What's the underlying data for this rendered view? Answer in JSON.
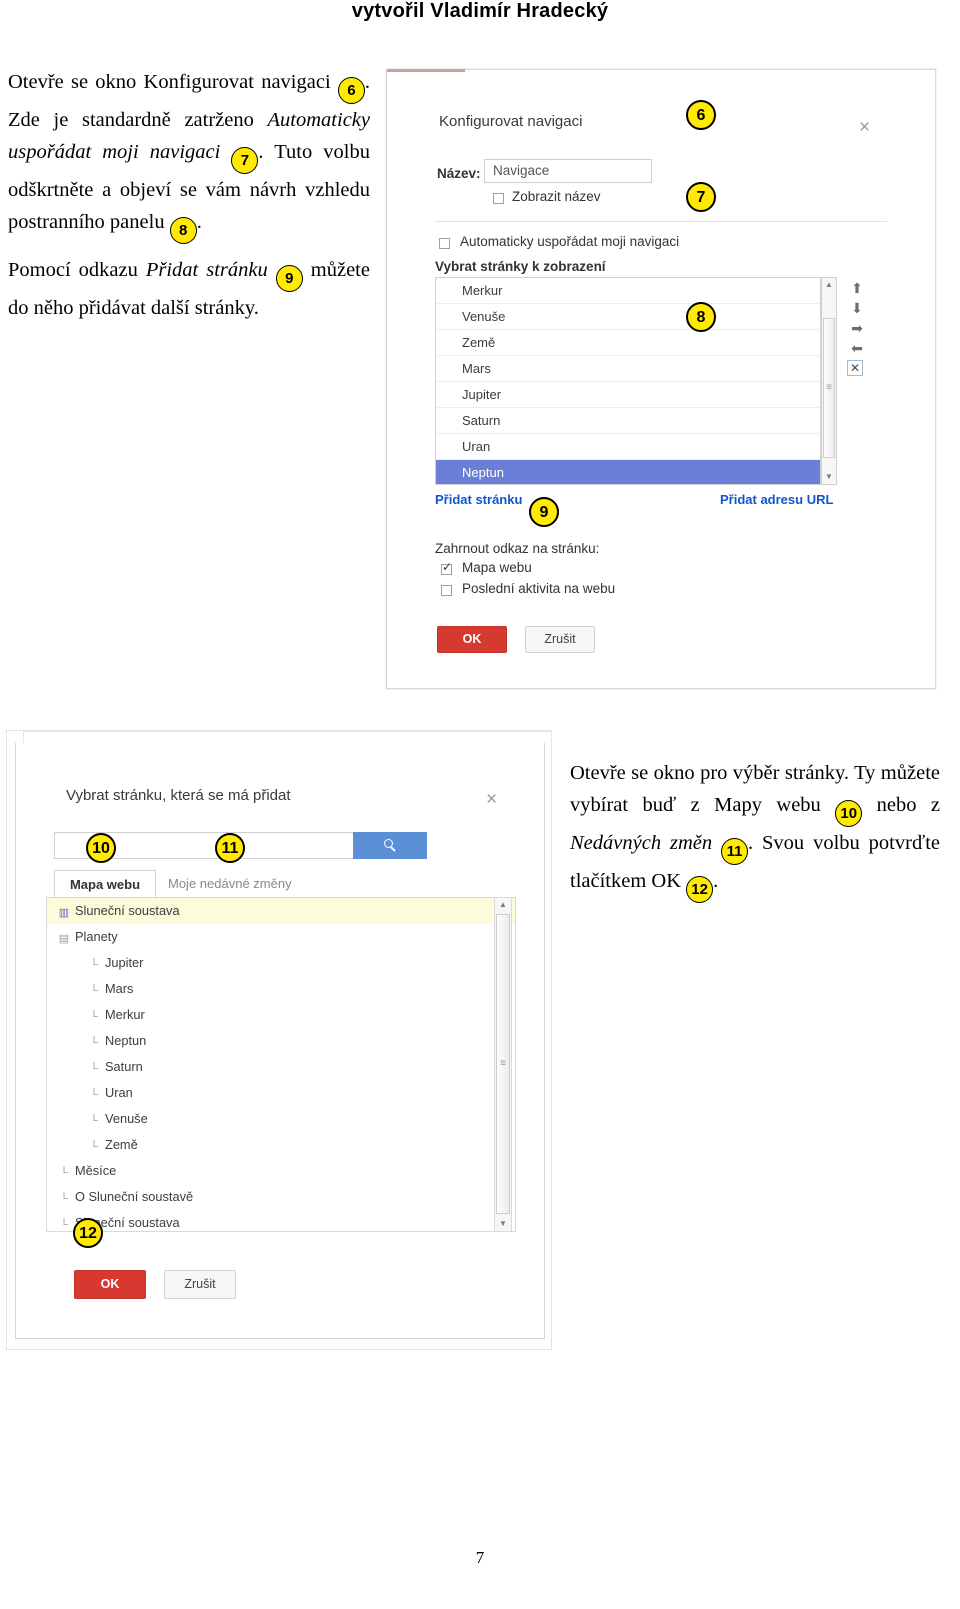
{
  "header": {
    "title": "vytvořil Vladimír Hradecký"
  },
  "page_number": "7",
  "text_left": {
    "p1_a": "Otevře se okno Konfigurovat navigaci ",
    "b6": "6",
    "p1_b": ". Zde je standardně zatrženo ",
    "p1_em1": "Automaticky uspořádat moji navigaci ",
    "b7": "7",
    "p1_c": ". Tuto volbu odškrtněte a objeví se vám návrh vzhledu postranního panelu ",
    "b8": "8",
    "p1_d": ".",
    "p2_a": "Pomocí odkazu ",
    "p2_em1": "Přidat stránku ",
    "b9": "9",
    "p2_b": " můžete do něho přidávat další stránky."
  },
  "text_right": {
    "p_a": "Otevře se okno pro výběr stránky. Ty můžete vybírat buď z Mapy webu ",
    "b10": "10",
    "p_b": " nebo z ",
    "p_em1": "Nedávných změn ",
    "b11": "11",
    "p_c": ". Svou volbu potvrďte tlačítkem OK ",
    "b12": "12",
    "p_d": "."
  },
  "configure_dialog": {
    "title": "Konfigurovat navigaci",
    "close_icon": "×",
    "name_label": "Název:",
    "name_value": "Navigace",
    "show_name_label": "Zobrazit název",
    "show_name_checked": false,
    "auto_arrange_label": "Automaticky uspořádat moji navigaci",
    "auto_arrange_checked": false,
    "select_pages_label": "Vybrat stránky k zobrazení",
    "pages": [
      {
        "label": "Merkur",
        "selected": false
      },
      {
        "label": "Venuše",
        "selected": false
      },
      {
        "label": "Země",
        "selected": false
      },
      {
        "label": "Mars",
        "selected": false
      },
      {
        "label": "Jupiter",
        "selected": false
      },
      {
        "label": "Saturn",
        "selected": false
      },
      {
        "label": "Uran",
        "selected": false
      },
      {
        "label": "Neptun",
        "selected": true
      }
    ],
    "tools": [
      {
        "icon": "move-up-icon",
        "glyph": "⬆"
      },
      {
        "icon": "move-down-icon",
        "glyph": "⬇"
      },
      {
        "icon": "indent-right-icon",
        "glyph": "➡"
      },
      {
        "icon": "outdent-left-icon",
        "glyph": "⬅"
      },
      {
        "icon": "remove-icon",
        "glyph": "✕"
      }
    ],
    "add_page_link": "Přidat stránku",
    "add_url_link": "Přidat adresu URL",
    "include_link_label": "Zahrnout odkaz na stránku:",
    "sitemap_label": "Mapa webu",
    "sitemap_checked": true,
    "recent_activity_label": "Poslední aktivita na webu",
    "recent_activity_checked": false,
    "ok_label": "OK",
    "cancel_label": "Zrušit",
    "callouts": {
      "c6": "6",
      "c7": "7",
      "c8": "8",
      "c9": "9"
    }
  },
  "pick_dialog": {
    "title": "Vybrat stránku, která se má přidat",
    "close_icon": "×",
    "search_value": "",
    "search_icon": "search-icon",
    "tabs": [
      {
        "label": "Mapa webu",
        "active": true
      },
      {
        "label": "Moje nedávné změny",
        "active": false
      }
    ],
    "tree": [
      {
        "label": "Sluneční soustava",
        "indent": 0,
        "icon": "page-icon",
        "highlighted": true
      },
      {
        "label": "Planety",
        "indent": 1,
        "icon": "folder-icon",
        "highlighted": false
      },
      {
        "label": "Jupiter",
        "indent": 2,
        "icon": "branch-icon",
        "highlighted": false
      },
      {
        "label": "Mars",
        "indent": 2,
        "icon": "branch-icon",
        "highlighted": false
      },
      {
        "label": "Merkur",
        "indent": 2,
        "icon": "branch-icon",
        "highlighted": false
      },
      {
        "label": "Neptun",
        "indent": 2,
        "icon": "branch-icon",
        "highlighted": false
      },
      {
        "label": "Saturn",
        "indent": 2,
        "icon": "branch-icon",
        "highlighted": false
      },
      {
        "label": "Uran",
        "indent": 2,
        "icon": "branch-icon",
        "highlighted": false
      },
      {
        "label": "Venuše",
        "indent": 2,
        "icon": "branch-icon",
        "highlighted": false
      },
      {
        "label": "Země",
        "indent": 2,
        "icon": "branch-icon",
        "highlighted": false
      },
      {
        "label": "Měsíce",
        "indent": 1,
        "icon": "branch-icon",
        "highlighted": false
      },
      {
        "label": "O Sluneční soustavě",
        "indent": 1,
        "icon": "branch-icon",
        "highlighted": false
      },
      {
        "label": "Sluneční soustava",
        "indent": 1,
        "icon": "branch-icon",
        "highlighted": false
      }
    ],
    "ok_label": "OK",
    "cancel_label": "Zrušit",
    "callouts": {
      "c10": "10",
      "c11": "11",
      "c12": "12"
    }
  }
}
